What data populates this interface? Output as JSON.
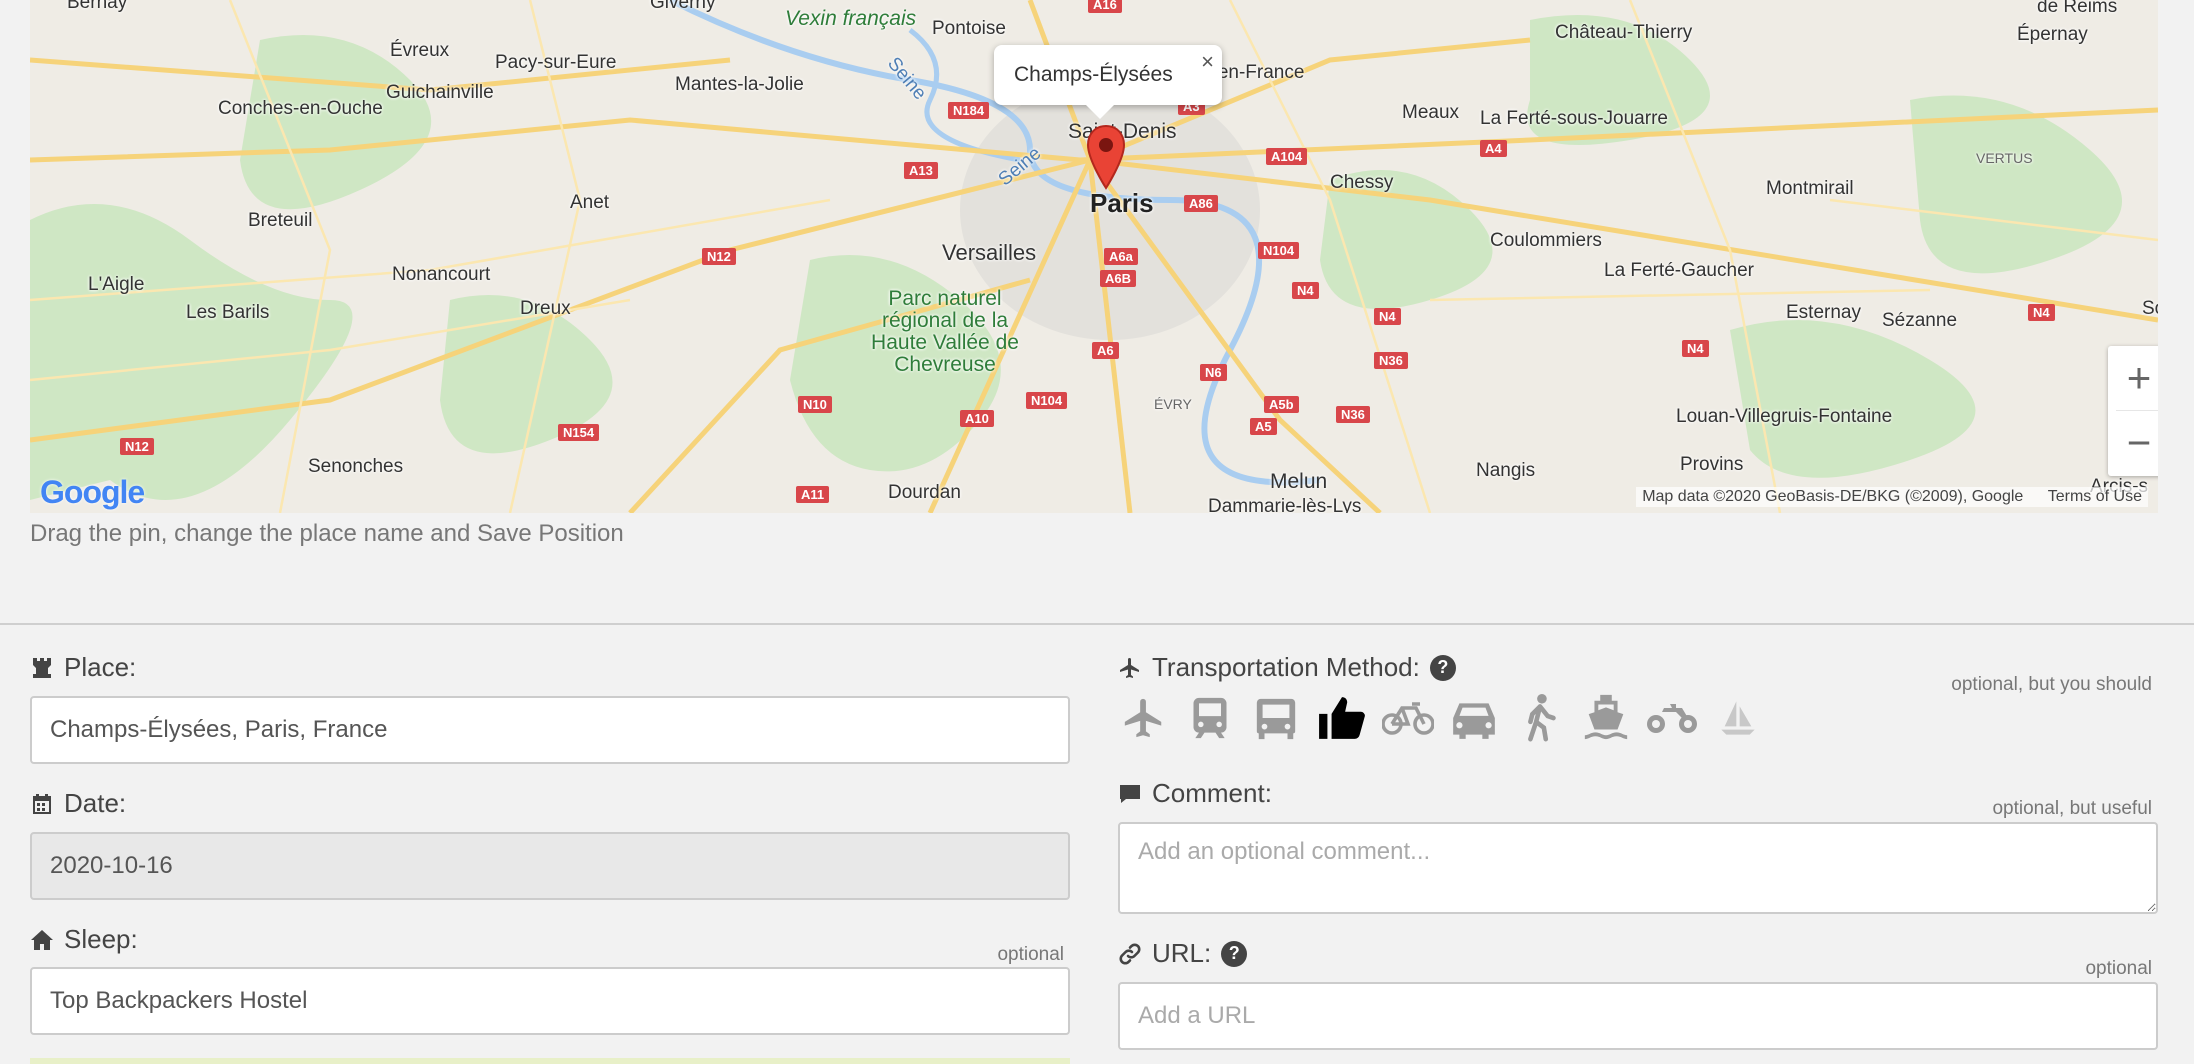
{
  "map": {
    "infowindow_label": "Champs-Élysées",
    "close_glyph": "×",
    "zoom_in": "+",
    "zoom_out": "−",
    "google_logo": "Google",
    "attribution": "Map data ©2020 GeoBasis-DE/BKG (©2009), Google",
    "terms": "Terms of Use",
    "places": {
      "bernay": "Bernay",
      "giverny": "Giverny",
      "vexin": "Vexin français",
      "pontoise": "Pontoise",
      "chateau_thierry": "Château-Thierry",
      "reims": "de Reims",
      "epernay": "Épernay",
      "evreux": "Évreux",
      "pacy": "Pacy-sur-Eure",
      "mantes": "Mantes-la-Jolie",
      "seine1": "Seine",
      "roissy": "y-en-France",
      "guichainville": "Guichainville",
      "conches": "Conches-en-Ouche",
      "saint_denis": "Saint-Denis",
      "meaux": "Meaux",
      "ferte_jouarre": "La Ferté-sous-Jouarre",
      "vertus": "VERTUS",
      "seine2": "Seine",
      "chessy": "Chessy",
      "montmirail": "Montmirail",
      "paris": "Paris",
      "breteuil": "Breteuil",
      "anet": "Anet",
      "versailles": "Versailles",
      "coulommiers": "Coulommiers",
      "nonancourt": "Nonancourt",
      "laigle": "L'Aigle",
      "ferte_gaucher": "La Ferté-Gaucher",
      "parc": "Parc naturel régional de la Haute Vallée de Chevreuse",
      "les_baris": "Les Barils",
      "dreux": "Dreux",
      "esternay": "Esternay",
      "sezanne": "Sézanne",
      "so": "So",
      "evry": "ÉVRY",
      "louan": "Louan-Villegruis-Fontaine",
      "senonches": "Senonches",
      "nangis": "Nangis",
      "provins": "Provins",
      "melun": "Melun",
      "arcis": "Arcis-s",
      "dourdan": "Dourdan",
      "dammarie": "Dammarie-lès-Lys"
    },
    "roads": {
      "a16": "A16",
      "n184": "N184",
      "a3": "A3",
      "a13": "A13",
      "a104": "A104",
      "a4": "A4",
      "a86": "A86",
      "n12a": "N12",
      "a6a": "A6a",
      "n104a": "N104",
      "a6b": "A6B",
      "n4a": "N4",
      "n4b": "N4",
      "n4c": "N4",
      "n4d": "N4",
      "a6": "A6",
      "n36a": "N36",
      "n6": "N6",
      "n10": "N10",
      "a10": "A10",
      "n104b": "N104",
      "a5b": "A5b",
      "n36b": "N36",
      "a5": "A5",
      "n154": "N154",
      "n12b": "N12",
      "a11": "A11"
    }
  },
  "hint": "Drag the pin, change the place name and Save Position",
  "form": {
    "place": {
      "label": "Place:",
      "value": "Champs-Élysées, Paris, France"
    },
    "date": {
      "label": "Date:",
      "value": "2020-10-16"
    },
    "sleep": {
      "label": "Sleep:",
      "optional": "optional",
      "value": "Top Backpackers Hostel"
    },
    "transport": {
      "label": "Transportation Method:",
      "optional": "optional, but you should",
      "help": "?",
      "methods": [
        "plane",
        "train",
        "bus",
        "thumb",
        "bicycle",
        "car",
        "walk",
        "ship",
        "motorbike",
        "sailboat"
      ],
      "selected": "thumb",
      "active_color": "#000000",
      "inactive_color": "#9a9a9a"
    },
    "comment": {
      "label": "Comment:",
      "optional": "optional, but useful",
      "placeholder": "Add an optional comment..."
    },
    "url": {
      "label": "URL:",
      "optional": "optional",
      "placeholder": "Add a URL",
      "help": "?"
    }
  }
}
